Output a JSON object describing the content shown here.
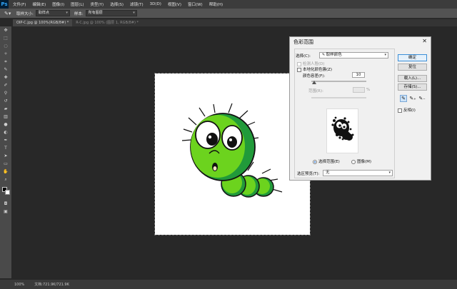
{
  "app": {
    "logo": "Ps",
    "menu": [
      "文件(F)",
      "编辑(E)",
      "图像(I)",
      "图层(L)",
      "类型(Y)",
      "选择(S)",
      "滤镜(T)",
      "3D(D)",
      "视图(V)",
      "窗口(W)",
      "帮助(H)"
    ]
  },
  "options_bar": {
    "tool_icon": "eyedropper-icon",
    "sample_size_label": "取样大小:",
    "sample_size_value": "取样点",
    "sample_label": "样本:",
    "sample_value": "所有图层"
  },
  "tabs": [
    {
      "label": "OIP-C.jpg @ 100%(RGB/8#) *",
      "active": true
    },
    {
      "label": "R-C.jpg @ 100% (图层 1, RGB/8#) *",
      "active": false
    }
  ],
  "toolbar": {
    "tools": [
      "move-icon",
      "marquee-icon",
      "lasso-icon",
      "quick-select-icon",
      "crop-icon",
      "eyedropper-icon",
      "healing-icon",
      "brush-icon",
      "stamp-icon",
      "history-brush-icon",
      "eraser-icon",
      "gradient-icon",
      "blur-icon",
      "dodge-icon",
      "pen-icon",
      "type-icon",
      "path-select-icon",
      "shape-icon",
      "hand-icon",
      "zoom-icon"
    ]
  },
  "status": {
    "zoom": "100%",
    "doc": "文档:721.9K/721.9K"
  },
  "dialog": {
    "title": "色彩范围",
    "select_label": "选择(C):",
    "select_value": "取样颜色",
    "detect_faces": "检测人脸(D)",
    "localized_clusters": "本地化颜色簇(Z)",
    "fuzziness_label": "颜色容差(F):",
    "fuzziness_value": "10",
    "range_label": "范围(R):",
    "range_unit": "%",
    "radio_selection": "选择范围(E)",
    "radio_image": "图像(M)",
    "preview_label": "选区预览(T):",
    "preview_value": "无",
    "buttons": {
      "ok": "确定",
      "reset": "复位",
      "load": "载入(L)...",
      "save": "存储(S)...",
      "invert": "反相(I)"
    }
  },
  "colors": {
    "ps_blue": "#2fa3f7",
    "caterpillar_green": "#6cd31e",
    "caterpillar_dark": "#219a3a"
  }
}
